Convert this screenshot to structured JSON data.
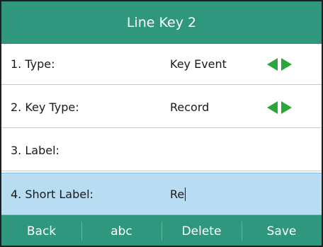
{
  "header": {
    "title": "Line Key 2"
  },
  "colors": {
    "title_bar": "#2e977d",
    "softkey_bar": "#2e977d",
    "arrow": "#2aa63a",
    "selected_row": "#b8dcf2"
  },
  "rows": [
    {
      "label": "1. Type:",
      "value": "Key Event",
      "icons": [
        "left-arrow-icon",
        "right-arrow-icon"
      ]
    },
    {
      "label": "2. Key Type:",
      "value": "Record",
      "icons": [
        "left-arrow-icon",
        "right-arrow-icon"
      ]
    },
    {
      "label": "3. Label:",
      "value": ""
    },
    {
      "label": "4. Short Label:",
      "value": "Re",
      "selected": true
    }
  ],
  "softkeys": [
    "Back",
    "abc",
    "Delete",
    "Save"
  ]
}
